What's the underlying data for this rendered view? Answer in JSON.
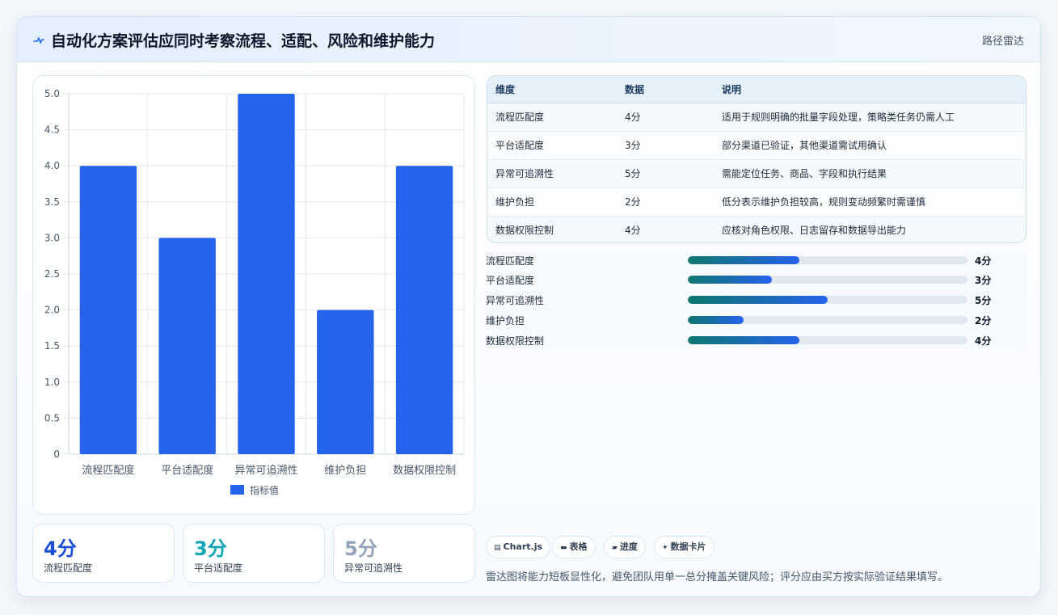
{
  "header": {
    "icon": "activity-icon",
    "title": "自动化方案评估应同时考察流程、适配、风险和维护能力",
    "badge": "路径雷达"
  },
  "chart_data": {
    "type": "bar",
    "categories": [
      "流程匹配度",
      "平台适配度",
      "异常可追溯性",
      "维护负担",
      "数据权限控制"
    ],
    "series": [
      {
        "name": "指标值",
        "values": [
          4,
          3,
          5,
          2,
          4
        ],
        "color": "#2563eb"
      }
    ],
    "ylim": [
      0,
      5
    ],
    "yticks": [
      "0",
      "0.5",
      "1.0",
      "1.5",
      "2.0",
      "2.5",
      "3.0",
      "3.5",
      "4.0",
      "4.5",
      "5.0"
    ],
    "grid": true,
    "legend": "bottom"
  },
  "stats": [
    {
      "value": "4分",
      "label": "流程匹配度",
      "color": "#1d4ed8"
    },
    {
      "value": "3分",
      "label": "平台适配度",
      "color": "#0ea5b7"
    },
    {
      "value": "5分",
      "label": "异常可追溯性",
      "color": "#94a3b8"
    }
  ],
  "table": {
    "headers": [
      "维度",
      "数据",
      "说明"
    ],
    "rows": [
      [
        "流程匹配度",
        "4分",
        "适用于规则明确的批量字段处理，策略类任务仍需人工"
      ],
      [
        "平台适配度",
        "3分",
        "部分渠道已验证，其他渠道需试用确认"
      ],
      [
        "异常可追溯性",
        "5分",
        "需能定位任务、商品、字段和执行结果"
      ],
      [
        "维护负担",
        "2分",
        "低分表示维护负担较高，规则变动频繁时需谨慎"
      ],
      [
        "数据权限控制",
        "4分",
        "应核对角色权限、日志留存和数据导出能力"
      ]
    ]
  },
  "progress": [
    {
      "label": "流程匹配度",
      "value": 4,
      "max": 10,
      "display": "4分"
    },
    {
      "label": "平台适配度",
      "value": 3,
      "max": 10,
      "display": "3分"
    },
    {
      "label": "异常可追溯性",
      "value": 5,
      "max": 10,
      "display": "5分"
    },
    {
      "label": "维护负担",
      "value": 2,
      "max": 10,
      "display": "2分"
    },
    {
      "label": "数据权限控制",
      "value": 4,
      "max": 10,
      "display": "4分"
    }
  ],
  "chips": [
    {
      "icon": "chart-icon",
      "glyph": "▤",
      "label": "Chart.js"
    },
    {
      "icon": "table-icon",
      "glyph": "▬",
      "label": "表格"
    },
    {
      "icon": "progress-icon",
      "glyph": "▰",
      "label": "进度"
    },
    {
      "icon": "card-icon",
      "glyph": "✦",
      "label": "数据卡片"
    }
  ],
  "footnote": "雷达图将能力短板显性化，避免团队用单一总分掩盖关键风险；评分应由买方按实际验证结果填写。"
}
